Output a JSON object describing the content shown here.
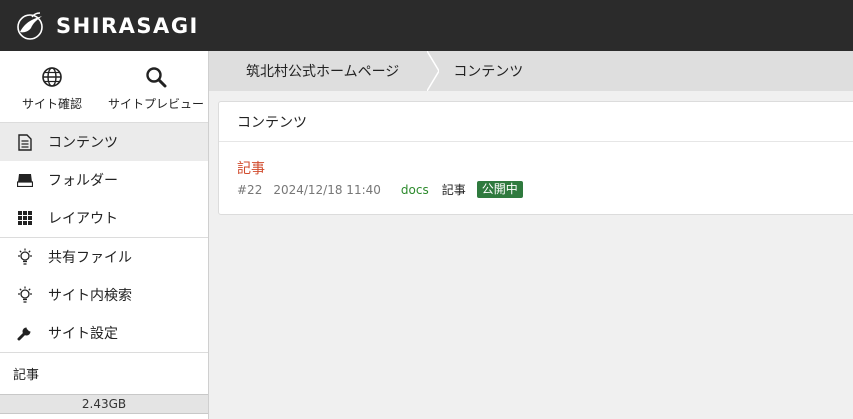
{
  "header": {
    "brand": "SHIRASAGI",
    "logo_icon": "heron-logo-icon",
    "background": "#2b2b2b"
  },
  "sidebar": {
    "quick_links": [
      {
        "label": "サイト確認",
        "icon": "globe-icon"
      },
      {
        "label": "サイトプレビュー",
        "icon": "search-icon"
      }
    ],
    "groups": [
      [
        {
          "label": "コンテンツ",
          "icon": "document-icon",
          "active": true
        },
        {
          "label": "フォルダー",
          "icon": "folder-icon",
          "active": false
        },
        {
          "label": "レイアウト",
          "icon": "grid-icon",
          "active": false
        }
      ],
      [
        {
          "label": "共有ファイル",
          "icon": "lightbulb-icon",
          "active": false
        },
        {
          "label": "サイト内検索",
          "icon": "lightbulb-icon",
          "active": false
        },
        {
          "label": "サイト設定",
          "icon": "wrench-icon",
          "active": false
        }
      ]
    ],
    "node_title": "記事",
    "disk_usage": "2.43GB"
  },
  "breadcrumb": [
    "筑北村公式ホームページ",
    "コンテンツ"
  ],
  "main": {
    "panel_title": "コンテンツ",
    "items": [
      {
        "title": "記事",
        "id": "#22",
        "updated": "2024/12/18 11:40",
        "filename": "docs",
        "type": "記事",
        "status": "公開中"
      }
    ]
  },
  "colors": {
    "link_red": "#d14b2d",
    "file_green": "#2c8a2c",
    "status_green": "#2f7a3e",
    "breadcrumb_bg": "#dedede"
  }
}
